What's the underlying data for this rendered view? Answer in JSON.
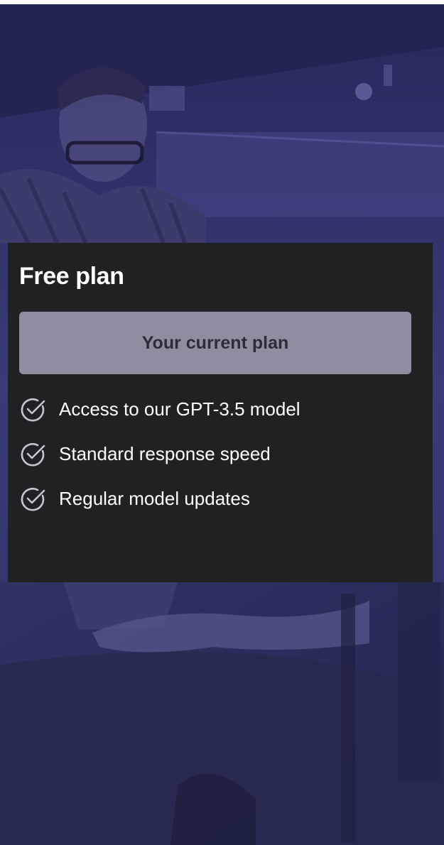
{
  "plan": {
    "title": "Free plan",
    "button_label": "Your current plan",
    "features": [
      {
        "text": "Access to our GPT-3.5 model",
        "icon": "check-circle-icon"
      },
      {
        "text": "Standard response speed",
        "icon": "check-circle-icon"
      },
      {
        "text": "Regular model updates",
        "icon": "check-circle-icon"
      }
    ]
  },
  "colors": {
    "card_background": "#202123",
    "button_background": "#8e8ea0",
    "button_text": "#2d2d3a",
    "overlay_tint": "#34346a",
    "text": "#ffffff"
  }
}
